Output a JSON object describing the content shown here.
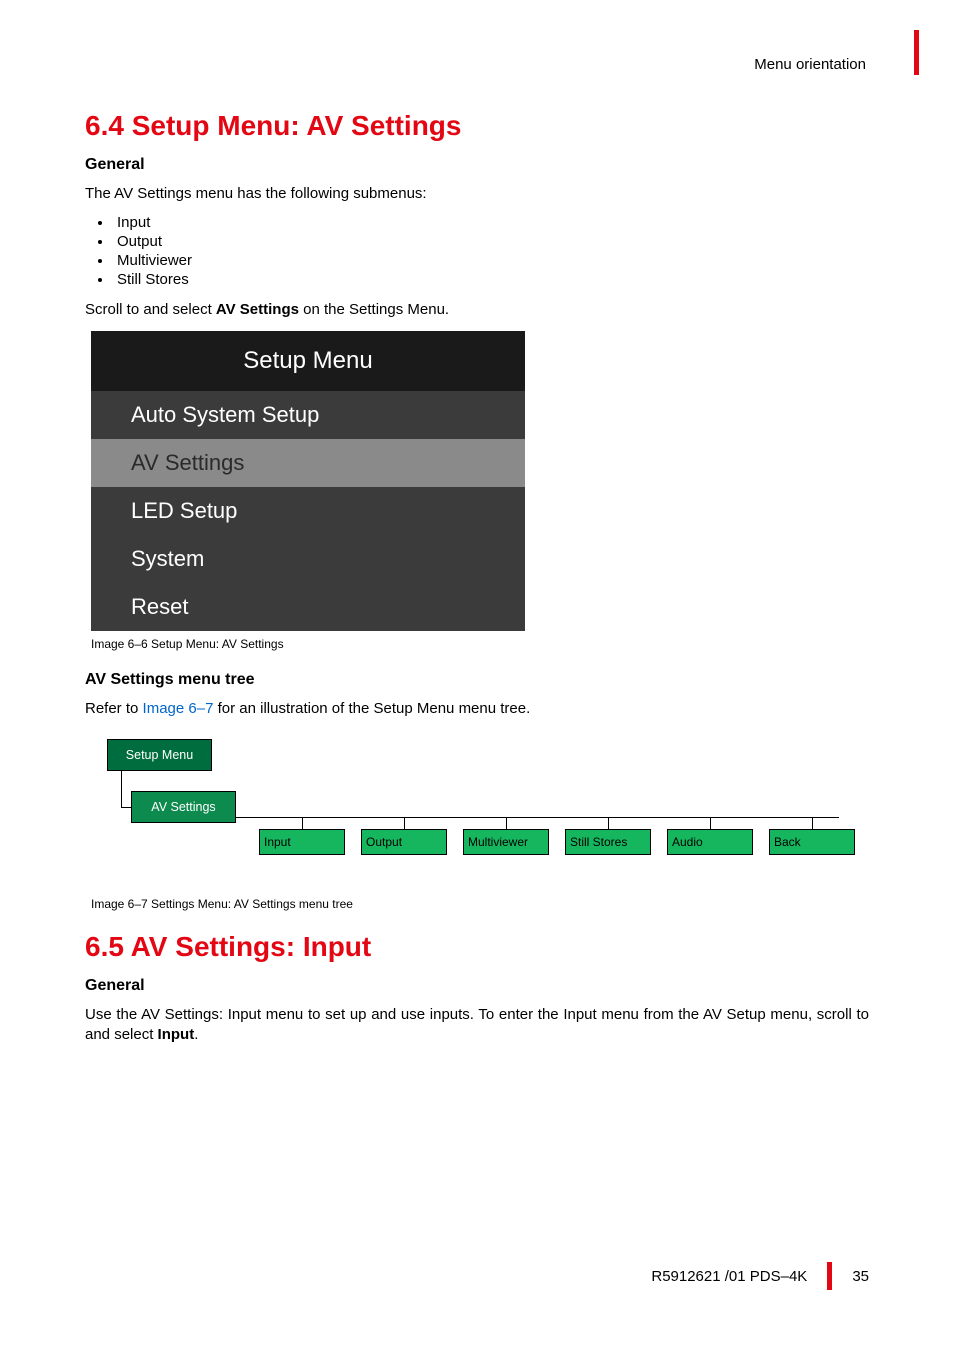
{
  "header": {
    "section_label": "Menu orientation"
  },
  "s64": {
    "title": "6.4 Setup Menu: AV Settings",
    "general_head": "General",
    "intro": "The AV Settings menu has the following submenus:",
    "bullets": [
      "Input",
      "Output",
      "Multiviewer",
      "Still Stores"
    ],
    "scroll_pre": "Scroll to and select ",
    "scroll_bold": "AV Settings",
    "scroll_post": " on the Settings Menu.",
    "caption": "Image 6–6  Setup Menu: AV Settings",
    "tree_head": "AV Settings menu tree",
    "tree_pre": "Refer to ",
    "tree_link": "Image 6–7",
    "tree_post": " for an illustration of the Setup Menu menu tree.",
    "tree_caption": "Image 6–7  Settings Menu: AV Settings menu tree"
  },
  "setup_menu": {
    "title": "Setup Menu",
    "items": [
      {
        "label": "Auto System Setup",
        "selected": false
      },
      {
        "label": "AV Settings",
        "selected": true
      },
      {
        "label": "LED Setup",
        "selected": false
      },
      {
        "label": "System",
        "selected": false
      },
      {
        "label": "Reset",
        "selected": false
      }
    ]
  },
  "tree": {
    "root": "Setup Menu",
    "sub": "AV Settings",
    "leaves": [
      "Input",
      "Output",
      "Multiviewer",
      "Still Stores",
      "Audio",
      "Back"
    ]
  },
  "s65": {
    "title": "6.5 AV Settings: Input",
    "general_head": "General",
    "body_pre": "Use the AV Settings: Input menu to set up and use inputs. To enter the Input menu from the AV Setup menu, scroll to and select ",
    "body_bold": "Input",
    "body_post": "."
  },
  "footer": {
    "doc": "R5912621 /01 PDS–4K",
    "page": "35"
  }
}
